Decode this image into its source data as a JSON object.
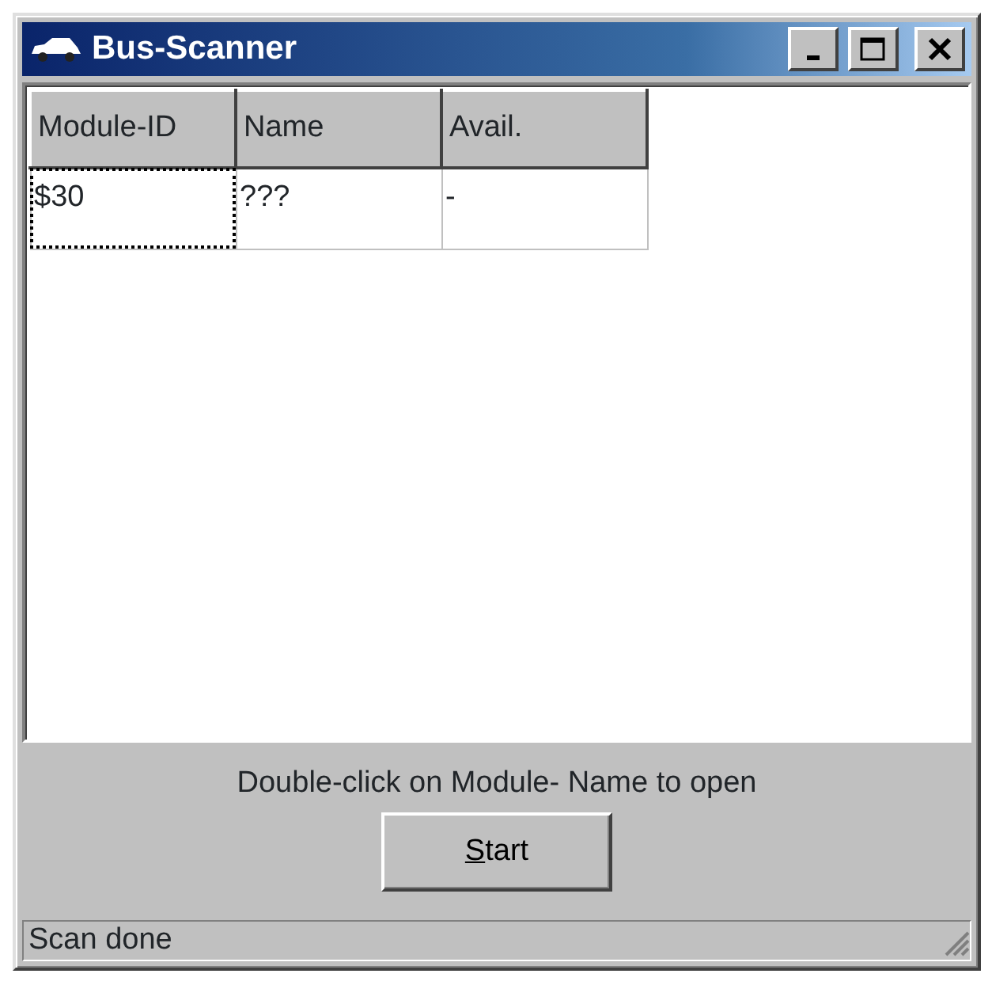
{
  "window": {
    "title": "Bus-Scanner"
  },
  "table": {
    "columns": [
      "Module-ID",
      "Name",
      "Avail."
    ],
    "rows": [
      {
        "cells": [
          {
            "text": "$30",
            "focused": true
          },
          {
            "text": "???",
            "focused": false
          },
          {
            "text": "-",
            "focused": false
          }
        ]
      }
    ]
  },
  "hint": "Double-click on Module- Name to open",
  "button": {
    "label": "Start",
    "access_key_underlined": true
  },
  "status_bar": "Scan done"
}
